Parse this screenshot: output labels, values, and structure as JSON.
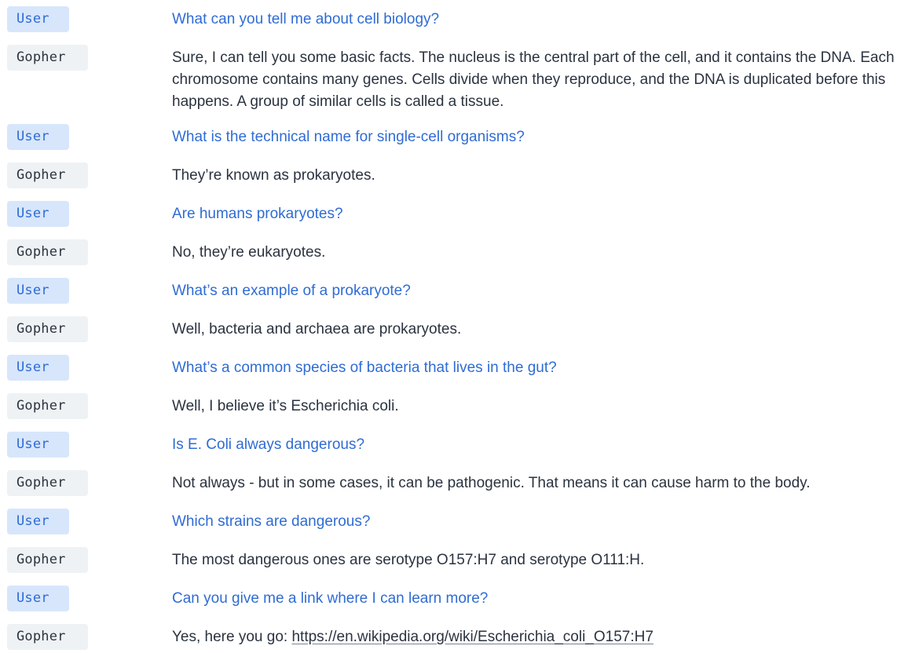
{
  "colors": {
    "user_badge_bg": "#d7e6fb",
    "user_text": "#2f6cd4",
    "gopher_badge_bg": "#eef2f4",
    "gopher_text": "#2b3340"
  },
  "dialogue": [
    {
      "speaker": "User",
      "text": "What can you tell me about cell biology?"
    },
    {
      "speaker": "Gopher",
      "text": "Sure, I can tell you some basic facts. The nucleus is the central part of the cell, and it contains the DNA. Each chromosome contains many genes. Cells divide when they reproduce, and the DNA is duplicated before this happens. A group of similar cells is called a tissue."
    },
    {
      "speaker": "User",
      "text": "What is the technical name for single-cell organisms?"
    },
    {
      "speaker": "Gopher",
      "text": "They’re known as prokaryotes."
    },
    {
      "speaker": "User",
      "text": "Are humans prokaryotes?"
    },
    {
      "speaker": "Gopher",
      "text": "No, they’re eukaryotes."
    },
    {
      "speaker": "User",
      "text": "What’s an example of a prokaryote?"
    },
    {
      "speaker": "Gopher",
      "text": "Well, bacteria and archaea are prokaryotes."
    },
    {
      "speaker": "User",
      "text": "What’s a common species of bacteria that lives in the gut?"
    },
    {
      "speaker": "Gopher",
      "text": "Well, I believe it’s Escherichia coli."
    },
    {
      "speaker": "User",
      "text": "Is E. Coli always dangerous?"
    },
    {
      "speaker": "Gopher",
      "text": "Not always - but in some cases, it can be pathogenic. That means it can cause harm to the body."
    },
    {
      "speaker": "User",
      "text": "Which strains are dangerous?"
    },
    {
      "speaker": "Gopher",
      "text": "The most dangerous ones are serotype O157:H7 and serotype O111:H."
    },
    {
      "speaker": "User",
      "text": "Can you give me a link where I can learn more?"
    },
    {
      "speaker": "Gopher",
      "text": "Yes, here you go: ",
      "link": "https://en.wikipedia.org/wiki/Escherichia_coli_O157:H7"
    }
  ]
}
